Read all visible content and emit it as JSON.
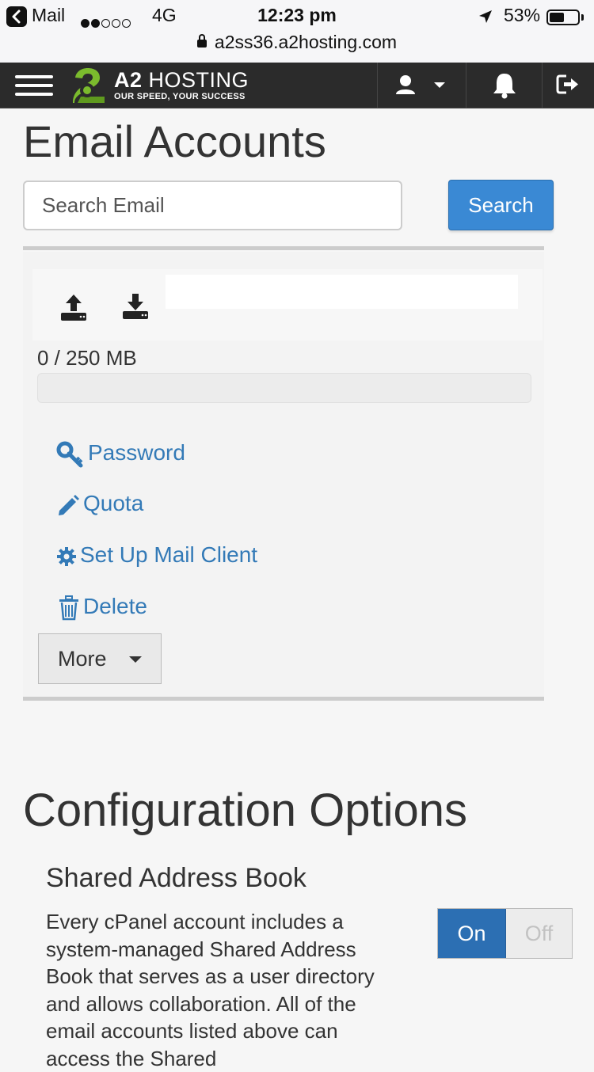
{
  "status_bar": {
    "back_app": "Mail",
    "network": "4G",
    "time": "12:23 pm",
    "battery_pct": "53%",
    "battery_level": 0.53,
    "url": "a2ss36.a2hosting.com"
  },
  "header": {
    "brand_a2": "A2",
    "brand_hosting": "HOSTING",
    "tagline": "OUR SPEED, YOUR SUCCESS"
  },
  "page": {
    "title": "Email Accounts",
    "search_placeholder": "Search Email",
    "search_button": "Search"
  },
  "account": {
    "quota_text": "0 / 250 MB",
    "quota_fraction": 0,
    "actions": {
      "password": "Password",
      "quota": "Quota",
      "setup": "Set Up Mail Client",
      "delete": "Delete"
    },
    "more_button": "More"
  },
  "config": {
    "title": "Configuration Options",
    "address_book_title": "Shared Address Book",
    "address_book_desc": "Every cPanel account includes a system-managed Shared Address Book that serves as a user directory and allows collaboration. All of the email accounts listed above can access the Shared",
    "toggle_on": "On",
    "toggle_off": "Off"
  },
  "colors": {
    "accent": "#3a89d4",
    "link": "#337ab7",
    "header_bg": "#2b2b2b",
    "logo_green": "#7bbb2d"
  }
}
